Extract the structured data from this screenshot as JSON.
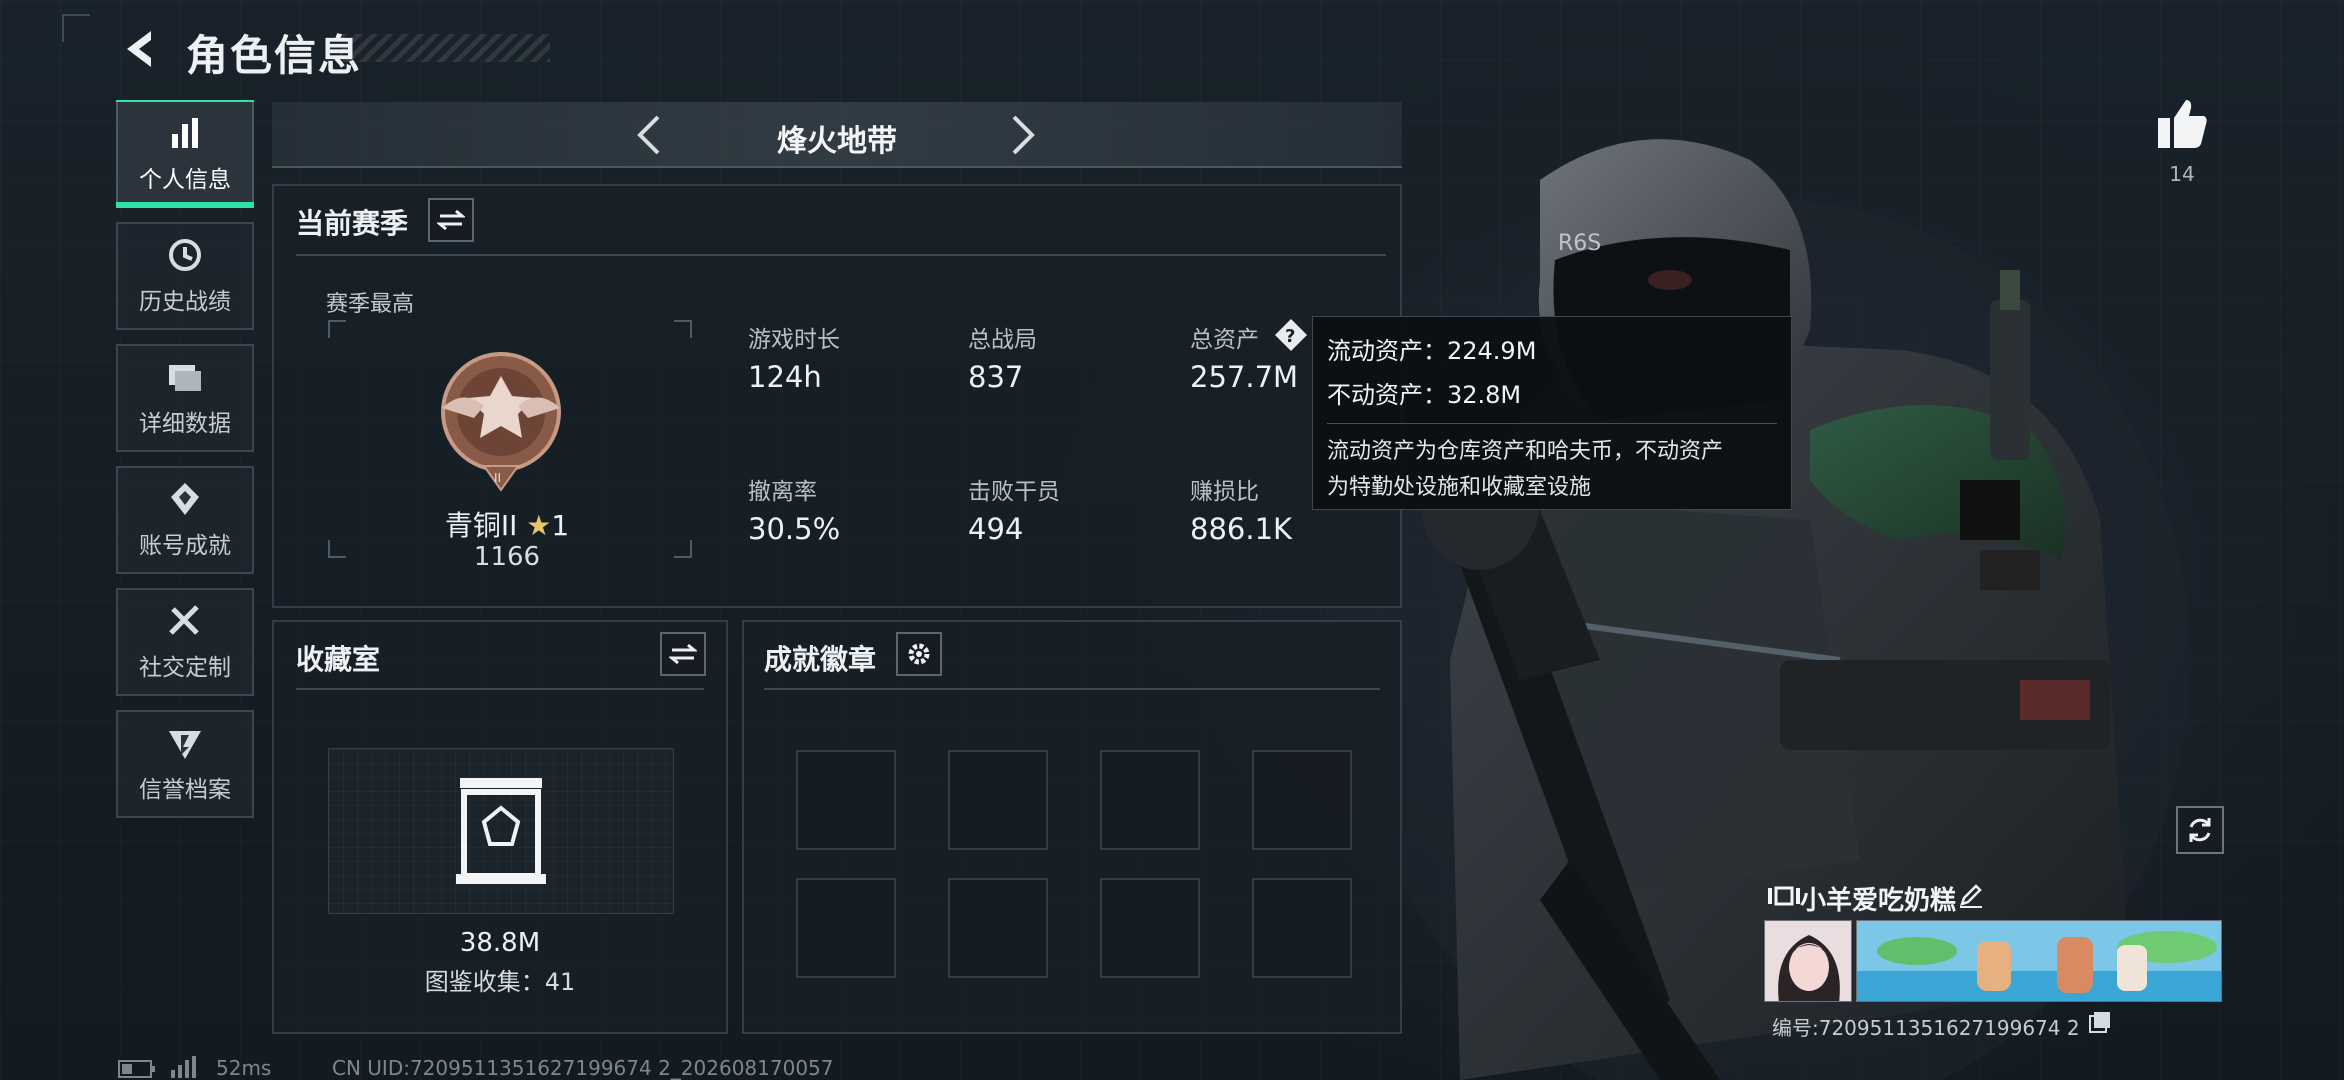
{
  "header": {
    "title": "角色信息"
  },
  "sidebar": {
    "items": [
      {
        "label": "个人信息",
        "icon": "bar-chart-icon"
      },
      {
        "label": "历史战绩",
        "icon": "history-icon"
      },
      {
        "label": "详细数据",
        "icon": "folder-icon"
      },
      {
        "label": "账号成就",
        "icon": "achievement-icon"
      },
      {
        "label": "社交定制",
        "icon": "tools-icon"
      },
      {
        "label": "信誉档案",
        "icon": "credit-icon"
      }
    ]
  },
  "mode": {
    "title": "烽火地带"
  },
  "season": {
    "title": "当前赛季",
    "best_label": "赛季最高",
    "rank_name": "青铜II",
    "rank_stars": "1",
    "rank_points": "1166",
    "stats": [
      {
        "label": "游戏时长",
        "value": "124h"
      },
      {
        "label": "总战局",
        "value": "837"
      },
      {
        "label": "总资产",
        "value": "257.7M"
      },
      {
        "label": "撤离率",
        "value": "30.5%"
      },
      {
        "label": "击败干员",
        "value": "494"
      },
      {
        "label": "赚损比",
        "value": "886.1K"
      }
    ]
  },
  "tooltip": {
    "line1": "流动资产：224.9M",
    "line2": "不动资产：32.8M",
    "desc1": "流动资产为仓库资产和哈夫币，不动资产",
    "desc2": "为特勤处设施和收藏室设施"
  },
  "collection": {
    "title": "收藏室",
    "value": "38.8M",
    "count_text": "图鉴收集：41"
  },
  "achievements": {
    "title": "成就徽章",
    "slots": 8
  },
  "social": {
    "likes": "14"
  },
  "player": {
    "name": "小羊爱吃奶糕",
    "id_text": "编号:7209511351627199674 2"
  },
  "status": {
    "ping": "52ms",
    "uid": "CN UID:7209511351627199674 2_202608170057"
  },
  "colors": {
    "accent": "#2fe1a3",
    "panel_border": "#333e48",
    "text": "#eef1f3"
  }
}
